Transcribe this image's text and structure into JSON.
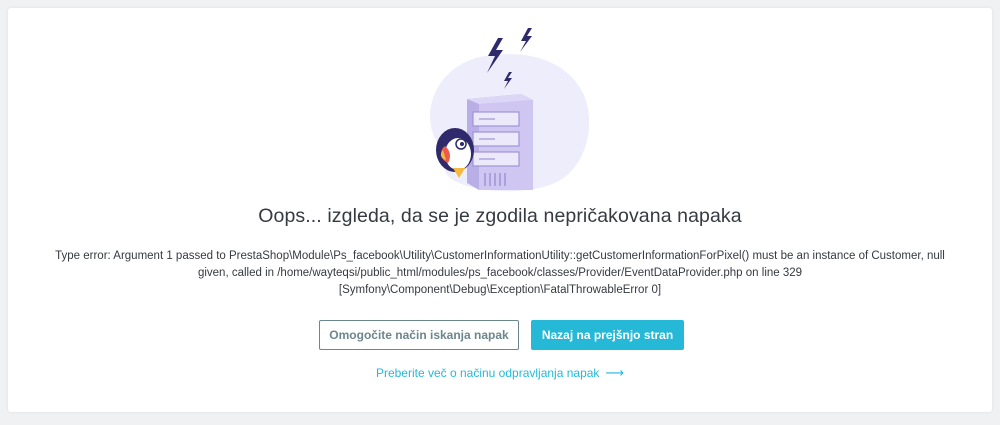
{
  "error_page": {
    "title": "Oops... izgleda, da se je zgodila nepričakovana napaka",
    "error_lines": [
      "Type error: Argument 1 passed to PrestaShop\\Module\\Ps_facebook\\Utility\\CustomerInformationUtility::getCustomerInformationForPixel() must be an instance of Customer, null",
      "given, called in /home/wayteqsi/public_html/modules/ps_facebook/classes/Provider/EventDataProvider.php on line 329",
      "[Symfony\\Component\\Debug\\Exception\\FatalThrowableError 0]"
    ],
    "buttons": {
      "debug_label": "Omogočite način iskanja napak",
      "back_label": "Nazaj na prejšnjo stran"
    },
    "learn_more_link": "Preberite več o načinu odpravljanja napak",
    "link_arrow": "⟶"
  },
  "illustration": {
    "icon": "server-with-puffin-illustration"
  },
  "colors": {
    "accent": "#25b9d7",
    "outline_button": "#6c868e",
    "text": "#363a41",
    "illustration_blob": "#eeedfb",
    "server": "#c7bfee"
  }
}
